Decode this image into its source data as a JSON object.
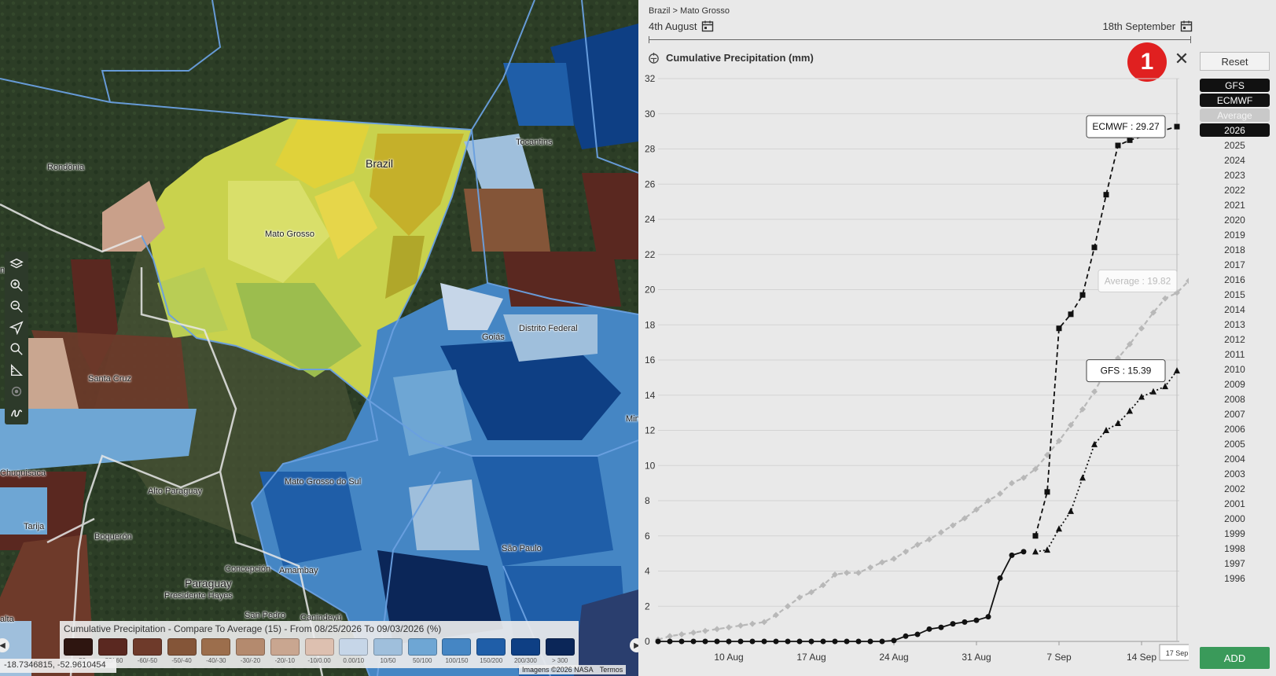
{
  "map": {
    "labels": [
      {
        "text": "Rondônia",
        "name": "map-label-rondonia"
      },
      {
        "text": "Brazil",
        "name": "map-label-brazil"
      },
      {
        "text": "Mato Grosso",
        "name": "map-label-mato-grosso"
      },
      {
        "text": "Tocantins",
        "name": "map-label-tocantins"
      },
      {
        "text": "Goiás",
        "name": "map-label-goias"
      },
      {
        "text": "Distrito Federal",
        "name": "map-label-distrito-federal"
      },
      {
        "text": "Santa Cruz",
        "name": "map-label-santa-cruz"
      },
      {
        "text": "Chuquisaca",
        "name": "map-label-chuquisaca"
      },
      {
        "text": "Alto Paraguay",
        "name": "map-label-alto-paraguay"
      },
      {
        "text": "Mato Grosso do Sul",
        "name": "map-label-mato-grosso-do-sul"
      },
      {
        "text": "Tarija",
        "name": "map-label-tarija"
      },
      {
        "text": "Boquerón",
        "name": "map-label-boqueron"
      },
      {
        "text": "Concepción",
        "name": "map-label-concepcion"
      },
      {
        "text": "Amambay",
        "name": "map-label-amambay"
      },
      {
        "text": "Paraguay",
        "name": "map-label-paraguay"
      },
      {
        "text": "Presidente Hayes",
        "name": "map-label-presidente-hayes"
      },
      {
        "text": "San Pedro",
        "name": "map-label-san-pedro"
      },
      {
        "text": "Canindeyú",
        "name": "map-label-canindeyu"
      },
      {
        "text": "São Paulo",
        "name": "map-label-sao-paulo"
      },
      {
        "text": "Min",
        "name": "map-label-minas"
      },
      {
        "text": "na",
        "name": "map-label-edge-na"
      },
      {
        "text": "alta",
        "name": "map-label-edge-alta"
      }
    ],
    "legend": {
      "title": "Cumulative Precipitation - Compare To Average (15) - From 08/25/2026 To 09/03/2026 (%)",
      "items": [
        {
          "label": "< -80",
          "color": "#2e1510"
        },
        {
          "label": "-80/-60",
          "color": "#5a2820"
        },
        {
          "label": "-60/-50",
          "color": "#6e3a2a"
        },
        {
          "label": "-50/-40",
          "color": "#845538"
        },
        {
          "label": "-40/-30",
          "color": "#9c6e4c"
        },
        {
          "label": "-30/-20",
          "color": "#b48a6e"
        },
        {
          "label": "-20/-10",
          "color": "#c9a690"
        },
        {
          "label": "-10/0.00",
          "color": "#ddc0b0"
        },
        {
          "label": "0.00/10",
          "color": "#c6d6e8"
        },
        {
          "label": "10/50",
          "color": "#9fbfdc"
        },
        {
          "label": "50/100",
          "color": "#6ea6d4"
        },
        {
          "label": "100/150",
          "color": "#4586c4"
        },
        {
          "label": "150/200",
          "color": "#1f5ea8"
        },
        {
          "label": "200/300",
          "color": "#0e3f84"
        },
        {
          "label": "> 300",
          "color": "#0b2658"
        }
      ]
    },
    "coords": "-18.7346815, -52.9610454",
    "attribution": "Imagens ©2026 NASA",
    "terms": "Termos",
    "left_arrow": "◀",
    "right_arrow": "▶"
  },
  "panel": {
    "breadcrumb": "Brazil > Mato Grosso",
    "date_start": "4th August",
    "date_end": "18th September",
    "chart_title": "Cumulative Precipitation (mm)",
    "badge": "1",
    "close": "✕",
    "reset": "Reset",
    "add": "ADD",
    "series_toggles": [
      {
        "label": "GFS",
        "state": "on"
      },
      {
        "label": "ECMWF",
        "state": "on"
      },
      {
        "label": "Average",
        "state": "avg"
      },
      {
        "label": "2026",
        "state": "on"
      },
      {
        "label": "2025",
        "state": "off"
      },
      {
        "label": "2024",
        "state": "off"
      },
      {
        "label": "2023",
        "state": "off"
      },
      {
        "label": "2022",
        "state": "off"
      },
      {
        "label": "2021",
        "state": "off"
      },
      {
        "label": "2020",
        "state": "off"
      },
      {
        "label": "2019",
        "state": "off"
      },
      {
        "label": "2018",
        "state": "off"
      },
      {
        "label": "2017",
        "state": "off"
      },
      {
        "label": "2016",
        "state": "off"
      },
      {
        "label": "2015",
        "state": "off"
      },
      {
        "label": "2014",
        "state": "off"
      },
      {
        "label": "2013",
        "state": "off"
      },
      {
        "label": "2012",
        "state": "off"
      },
      {
        "label": "2011",
        "state": "off"
      },
      {
        "label": "2010",
        "state": "off"
      },
      {
        "label": "2009",
        "state": "off"
      },
      {
        "label": "2008",
        "state": "off"
      },
      {
        "label": "2007",
        "state": "off"
      },
      {
        "label": "2006",
        "state": "off"
      },
      {
        "label": "2005",
        "state": "off"
      },
      {
        "label": "2004",
        "state": "off"
      },
      {
        "label": "2003",
        "state": "off"
      },
      {
        "label": "2002",
        "state": "off"
      },
      {
        "label": "2001",
        "state": "off"
      },
      {
        "label": "2000",
        "state": "off"
      },
      {
        "label": "1999",
        "state": "off"
      },
      {
        "label": "1998",
        "state": "off"
      },
      {
        "label": "1997",
        "state": "off"
      },
      {
        "label": "1996",
        "state": "off"
      }
    ]
  },
  "chart_data": {
    "type": "line",
    "title": "Cumulative Precipitation (mm)",
    "ylim": [
      0,
      32
    ],
    "yticks": [
      0,
      2,
      4,
      6,
      8,
      10,
      12,
      14,
      16,
      18,
      20,
      22,
      24,
      26,
      28,
      30,
      32
    ],
    "x_ticks": [
      {
        "day": 10,
        "label": "10 Aug"
      },
      {
        "day": 17,
        "label": "17 Aug"
      },
      {
        "day": 24,
        "label": "24 Aug"
      },
      {
        "day": 31,
        "label": "31 Aug"
      },
      {
        "day": 38,
        "label": "7 Sep"
      },
      {
        "day": 45,
        "label": "14 Sep"
      }
    ],
    "xlim": [
      4,
      49
    ],
    "crosshair": {
      "day": 48,
      "label": "17 Sep"
    },
    "grid": true,
    "series": [
      {
        "name": "2026",
        "color": "#111111",
        "dash": "solid",
        "marker": "circle",
        "points": [
          [
            4,
            0
          ],
          [
            5,
            0
          ],
          [
            6,
            0
          ],
          [
            7,
            0
          ],
          [
            8,
            0
          ],
          [
            9,
            0
          ],
          [
            10,
            0
          ],
          [
            11,
            0
          ],
          [
            12,
            0
          ],
          [
            13,
            0
          ],
          [
            14,
            0
          ],
          [
            15,
            0
          ],
          [
            16,
            0
          ],
          [
            17,
            0
          ],
          [
            18,
            0
          ],
          [
            19,
            0
          ],
          [
            20,
            0
          ],
          [
            21,
            0
          ],
          [
            22,
            0
          ],
          [
            23,
            0
          ],
          [
            24,
            0.05
          ],
          [
            25,
            0.3
          ],
          [
            26,
            0.4
          ],
          [
            27,
            0.7
          ],
          [
            28,
            0.8
          ],
          [
            29,
            1.0
          ],
          [
            30,
            1.1
          ],
          [
            31,
            1.2
          ],
          [
            32,
            1.4
          ],
          [
            33,
            3.6
          ],
          [
            34,
            4.9
          ],
          [
            35,
            5.1
          ]
        ]
      },
      {
        "name": "ECMWF",
        "color": "#111111",
        "dash": "dashed",
        "marker": "square",
        "points": [
          [
            36,
            6.0
          ],
          [
            37,
            8.5
          ],
          [
            38,
            17.8
          ],
          [
            39,
            18.6
          ],
          [
            40,
            19.7
          ],
          [
            41,
            22.4
          ],
          [
            42,
            25.4
          ],
          [
            43,
            28.2
          ],
          [
            44,
            28.5
          ],
          [
            48,
            29.27
          ]
        ],
        "label": "ECMWF : 29.27"
      },
      {
        "name": "GFS",
        "color": "#111111",
        "dash": "dotted",
        "marker": "triangle",
        "points": [
          [
            36,
            5.1
          ],
          [
            37,
            5.2
          ],
          [
            38,
            6.4
          ],
          [
            39,
            7.4
          ],
          [
            40,
            9.3
          ],
          [
            41,
            11.2
          ],
          [
            42,
            12.0
          ],
          [
            43,
            12.4
          ],
          [
            44,
            13.1
          ],
          [
            45,
            13.9
          ],
          [
            46,
            14.2
          ],
          [
            47,
            14.5
          ],
          [
            48,
            15.39
          ]
        ],
        "label": "GFS : 15.39"
      },
      {
        "name": "Average",
        "color": "#b8b8b8",
        "dash": "dashed",
        "marker": "diamond",
        "points": [
          [
            4,
            0.1
          ],
          [
            5,
            0.3
          ],
          [
            6,
            0.4
          ],
          [
            7,
            0.5
          ],
          [
            8,
            0.6
          ],
          [
            9,
            0.7
          ],
          [
            10,
            0.8
          ],
          [
            11,
            0.9
          ],
          [
            12,
            1.0
          ],
          [
            13,
            1.1
          ],
          [
            14,
            1.5
          ],
          [
            15,
            2.0
          ],
          [
            16,
            2.5
          ],
          [
            17,
            2.8
          ],
          [
            18,
            3.2
          ],
          [
            19,
            3.8
          ],
          [
            20,
            3.9
          ],
          [
            21,
            3.9
          ],
          [
            22,
            4.2
          ],
          [
            23,
            4.5
          ],
          [
            24,
            4.7
          ],
          [
            25,
            5.1
          ],
          [
            26,
            5.5
          ],
          [
            27,
            5.8
          ],
          [
            28,
            6.2
          ],
          [
            29,
            6.6
          ],
          [
            30,
            7.0
          ],
          [
            31,
            7.5
          ],
          [
            32,
            8.0
          ],
          [
            33,
            8.4
          ],
          [
            34,
            9.0
          ],
          [
            35,
            9.3
          ],
          [
            36,
            9.8
          ],
          [
            37,
            10.6
          ],
          [
            38,
            11.4
          ],
          [
            39,
            12.3
          ],
          [
            40,
            13.2
          ],
          [
            41,
            14.2
          ],
          [
            42,
            15.4
          ],
          [
            43,
            16.1
          ],
          [
            44,
            16.9
          ],
          [
            45,
            17.8
          ],
          [
            46,
            18.7
          ],
          [
            47,
            19.5
          ],
          [
            48,
            19.82
          ],
          [
            49,
            20.5
          ]
        ],
        "label": "Average : 19.82"
      }
    ]
  }
}
